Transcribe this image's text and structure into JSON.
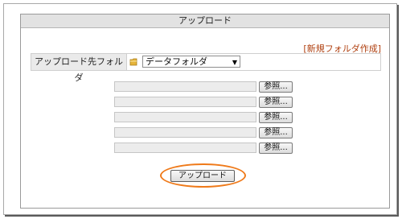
{
  "panel": {
    "title": "アップロード"
  },
  "links": {
    "new_folder": "[新規フォルダ作成]"
  },
  "destination": {
    "label": "アップロード先フォルダ",
    "folder_icon": "folder-icon",
    "selected": "データフォルダ"
  },
  "file_fields": [
    {
      "value": "",
      "browse_label": "参照..."
    },
    {
      "value": "",
      "browse_label": "参照..."
    },
    {
      "value": "",
      "browse_label": "参照..."
    },
    {
      "value": "",
      "browse_label": "参照..."
    },
    {
      "value": "",
      "browse_label": "参照..."
    }
  ],
  "actions": {
    "upload_label": "アップロード"
  },
  "colors": {
    "link": "#b04010",
    "highlight": "#ef7a1a",
    "header_bg": "#e2e2e2",
    "label_bg": "#eaeaea",
    "folder_yellow": "#e6b43a"
  }
}
